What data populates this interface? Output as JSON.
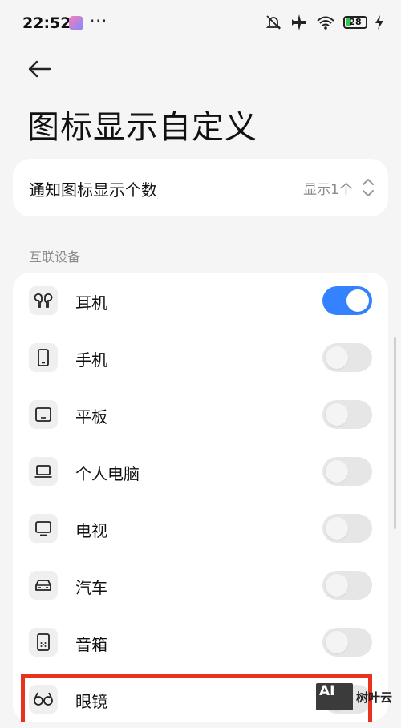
{
  "status_bar": {
    "time": "22:52",
    "more": "···",
    "battery": "28",
    "icons": [
      "mute-icon",
      "airplane-icon",
      "wifi-icon",
      "battery-icon",
      "charging-icon"
    ]
  },
  "header": {
    "title": "图标显示自定义"
  },
  "notification_count": {
    "label": "通知图标显示个数",
    "value": "显示1个"
  },
  "section": {
    "title": "互联设备"
  },
  "devices": [
    {
      "label": "耳机",
      "icon": "earbuds-icon",
      "enabled": true
    },
    {
      "label": "手机",
      "icon": "phone-icon",
      "enabled": false
    },
    {
      "label": "平板",
      "icon": "tablet-icon",
      "enabled": false
    },
    {
      "label": "个人电脑",
      "icon": "laptop-icon",
      "enabled": false
    },
    {
      "label": "电视",
      "icon": "tv-icon",
      "enabled": false
    },
    {
      "label": "汽车",
      "icon": "car-icon",
      "enabled": false
    },
    {
      "label": "音箱",
      "icon": "speaker-icon",
      "enabled": false
    },
    {
      "label": "眼镜",
      "icon": "glasses-icon",
      "enabled": false
    }
  ],
  "watermark": {
    "text": "树叶云",
    "logo": "AI"
  },
  "colors": {
    "accent": "#3482ff",
    "highlight": "#e8321e"
  }
}
